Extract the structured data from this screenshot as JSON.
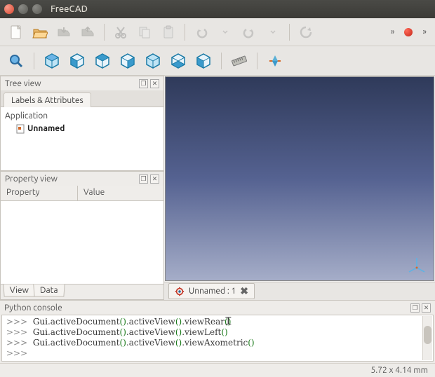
{
  "window": {
    "title": "FreeCAD"
  },
  "panels": {
    "tree": {
      "title": "Tree view",
      "tab": "Labels & Attributes",
      "root": "Application",
      "doc": "Unnamed"
    },
    "prop": {
      "title": "Property view",
      "col1": "Property",
      "col2": "Value",
      "tab_view": "View",
      "tab_data": "Data"
    },
    "console": {
      "title": "Python console"
    }
  },
  "doc_tab": {
    "label": "Unnamed : 1"
  },
  "console_lines": [
    {
      "prompt": ">>>",
      "obj": "Gui",
      "m1": "activeDocument",
      "m2": "activeView",
      "m3": "viewRear"
    },
    {
      "prompt": ">>>",
      "obj": "Gui",
      "m1": "activeDocument",
      "m2": "activeView",
      "m3": "viewLeft"
    },
    {
      "prompt": ">>>",
      "obj": "Gui",
      "m1": "activeDocument",
      "m2": "activeView",
      "m3": "viewAxometric"
    },
    {
      "prompt": ">>>"
    }
  ],
  "status": {
    "dims": "5.72 x 4.14 mm"
  },
  "overflow": "»",
  "close_glyph": "✕"
}
